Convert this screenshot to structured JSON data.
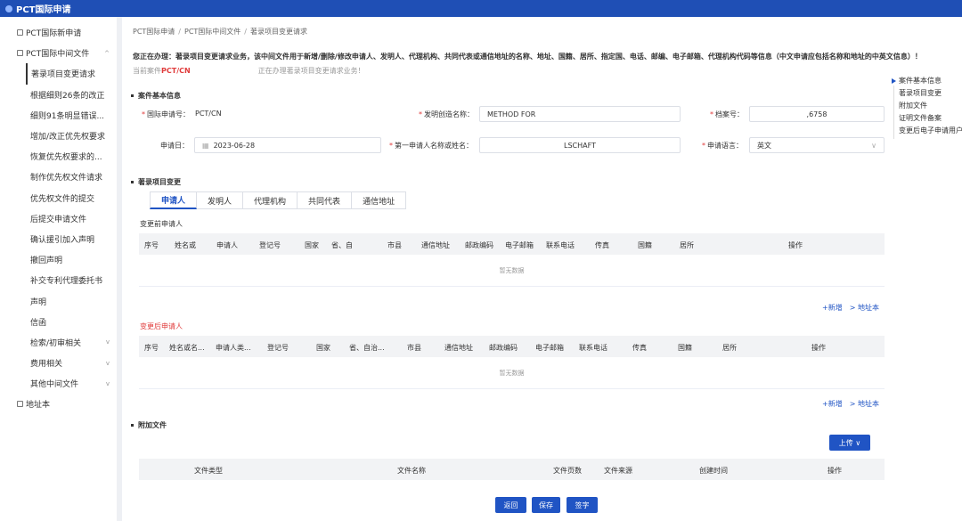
{
  "app": {
    "title": "PCT国际申请"
  },
  "sidebar": {
    "items": [
      {
        "label": "PCT国际新申请",
        "type": "top",
        "chevron": ""
      },
      {
        "label": "PCT国际中间文件",
        "type": "top",
        "chevron": "^"
      },
      {
        "label": "著录项目变更请求",
        "type": "sub",
        "active": true
      },
      {
        "label": "根据细则26条的改正",
        "type": "sub"
      },
      {
        "label": "细则91条明显错误...",
        "type": "sub"
      },
      {
        "label": "增加/改正优先权要求",
        "type": "sub"
      },
      {
        "label": "恢复优先权要求的...",
        "type": "sub"
      },
      {
        "label": "制作优先权文件请求",
        "type": "sub"
      },
      {
        "label": "优先权文件的提交",
        "type": "sub"
      },
      {
        "label": "后提交申请文件",
        "type": "sub"
      },
      {
        "label": "确认援引加入声明",
        "type": "sub"
      },
      {
        "label": "撤回声明",
        "type": "sub"
      },
      {
        "label": "补交专利代理委托书",
        "type": "sub"
      },
      {
        "label": "声明",
        "type": "sub"
      },
      {
        "label": "信函",
        "type": "sub"
      },
      {
        "label": "检索/初审相关",
        "type": "sub",
        "chevron": "v"
      },
      {
        "label": "费用相关",
        "type": "sub",
        "chevron": "v"
      },
      {
        "label": "其他中间文件",
        "type": "sub",
        "chevron": "v"
      },
      {
        "label": "地址本",
        "type": "top",
        "chevron": ""
      }
    ]
  },
  "breadcrumb": [
    "PCT国际申请",
    "PCT国际中间文件",
    "著录项目变更请求"
  ],
  "notice": "您正在办理：著录项目变更请求业务，该中间文件用于新增/删除/修改申请人、发明人、代理机构、共同代表或通信地址的名称、地址、国籍、居所、指定国、电话、邮编、电子邮箱、代理机构代码等信息（中文申请应包括名称和地址的中英文信息）！",
  "current_case": {
    "prefix": "当前案件",
    "case_no": "PCT/CN",
    "suffix": "正在办理著录项目变更请求业务！"
  },
  "case_info": {
    "section_title": "案件基本信息",
    "intl_app_no_label": "国际申请号：",
    "intl_app_no_value": "PCT/CN",
    "invention_name_label": "发明创造名称：",
    "invention_name_value": "METHOD FOR",
    "file_no_label": "档案号：",
    "file_no_value": ",6758",
    "filing_date_label": "申请日：",
    "filing_date_value": "2023-06-28",
    "first_applicant_label": "第一申请人名称或姓名：",
    "first_applicant_value": "LSCHAFT",
    "language_label": "申请语言：",
    "language_value": "英文"
  },
  "change_section": {
    "section_title": "著录项目变更",
    "tabs": [
      "申请人",
      "发明人",
      "代理机构",
      "共同代表",
      "通信地址"
    ],
    "before_title": "变更前申请人",
    "before_headers": [
      "序号",
      "姓名或",
      "申请人",
      "登记号",
      "国家",
      "省、自",
      "市县",
      "通信地址",
      "邮政编码",
      "电子邮箱",
      "联系电话",
      "传真",
      "国籍",
      "居所",
      "操作"
    ],
    "after_title": "变更后申请人",
    "after_headers": [
      "序号",
      "姓名或名...",
      "申请人类...",
      "登记号",
      "国家",
      "省、自治...",
      "市县",
      "通信地址",
      "邮政编码",
      "电子邮箱",
      "联系电话",
      "传真",
      "国籍",
      "居所",
      "操作"
    ],
    "empty_text": "暂无数据",
    "add_link": "+新增",
    "address_book_link": "> 地址本"
  },
  "attachments": {
    "section_title": "附加文件",
    "upload_label": "上传 ∨",
    "headers": [
      "文件类型",
      "文件名称",
      "文件页数",
      "文件来源",
      "创建时间",
      "操作"
    ]
  },
  "footer": {
    "back": "返回",
    "save": "保存",
    "sign": "签字"
  },
  "anchors": [
    "案件基本信息",
    "著录项目变更",
    "附加文件",
    "证明文件备案",
    "变更后电子申请用户"
  ],
  "colors": {
    "primary": "#2054c4",
    "topbar": "#1f4fb5",
    "required": "#e03b3b"
  }
}
